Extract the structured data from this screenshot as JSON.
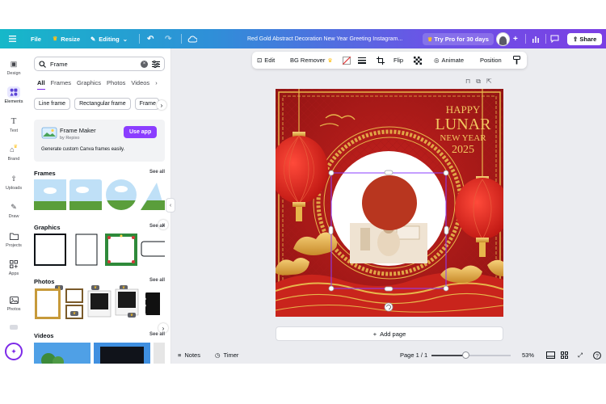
{
  "topbar": {
    "file": "File",
    "resize": "Resize",
    "editing": "Editing",
    "doc_title": "Red Gold Abstract Decoration New Year Greeting Instagram...",
    "try_pro": "Try Pro for 30 days",
    "share": "Share"
  },
  "rail": {
    "items": [
      "Design",
      "Elements",
      "Text",
      "Brand",
      "Uploads",
      "Draw",
      "Projects",
      "Apps",
      "Photos"
    ]
  },
  "search": {
    "value": "Frame"
  },
  "tabs": [
    "All",
    "Frames",
    "Graphics",
    "Photos",
    "Videos"
  ],
  "chips": [
    "Line frame",
    "Rectangular frame",
    "Frame"
  ],
  "promo": {
    "title": "Frame Maker",
    "by": "by Repixo",
    "desc": "Generate custom Canva frames easily.",
    "cta": "Use app"
  },
  "sections": {
    "frames": "Frames",
    "graphics": "Graphics",
    "photos": "Photos",
    "videos": "Videos",
    "see_all": "See all"
  },
  "context_toolbar": {
    "edit": "Edit",
    "bg_remover": "BG Remover",
    "flip": "Flip",
    "animate": "Animate",
    "position": "Position"
  },
  "canvas": {
    "line1": "HAPPY",
    "line2": "LUNAR",
    "line3": "NEW YEAR",
    "line4": "2025"
  },
  "add_page": "Add page",
  "footer": {
    "notes": "Notes",
    "timer": "Timer",
    "page": "Page 1 / 1",
    "zoom_fraction": 0.43,
    "zoom": "53%"
  },
  "colors": {
    "accent": "#8b3dff",
    "poster_red": "#b81d1d",
    "gold": "#e7b64b",
    "selection": "#8b3dff"
  }
}
